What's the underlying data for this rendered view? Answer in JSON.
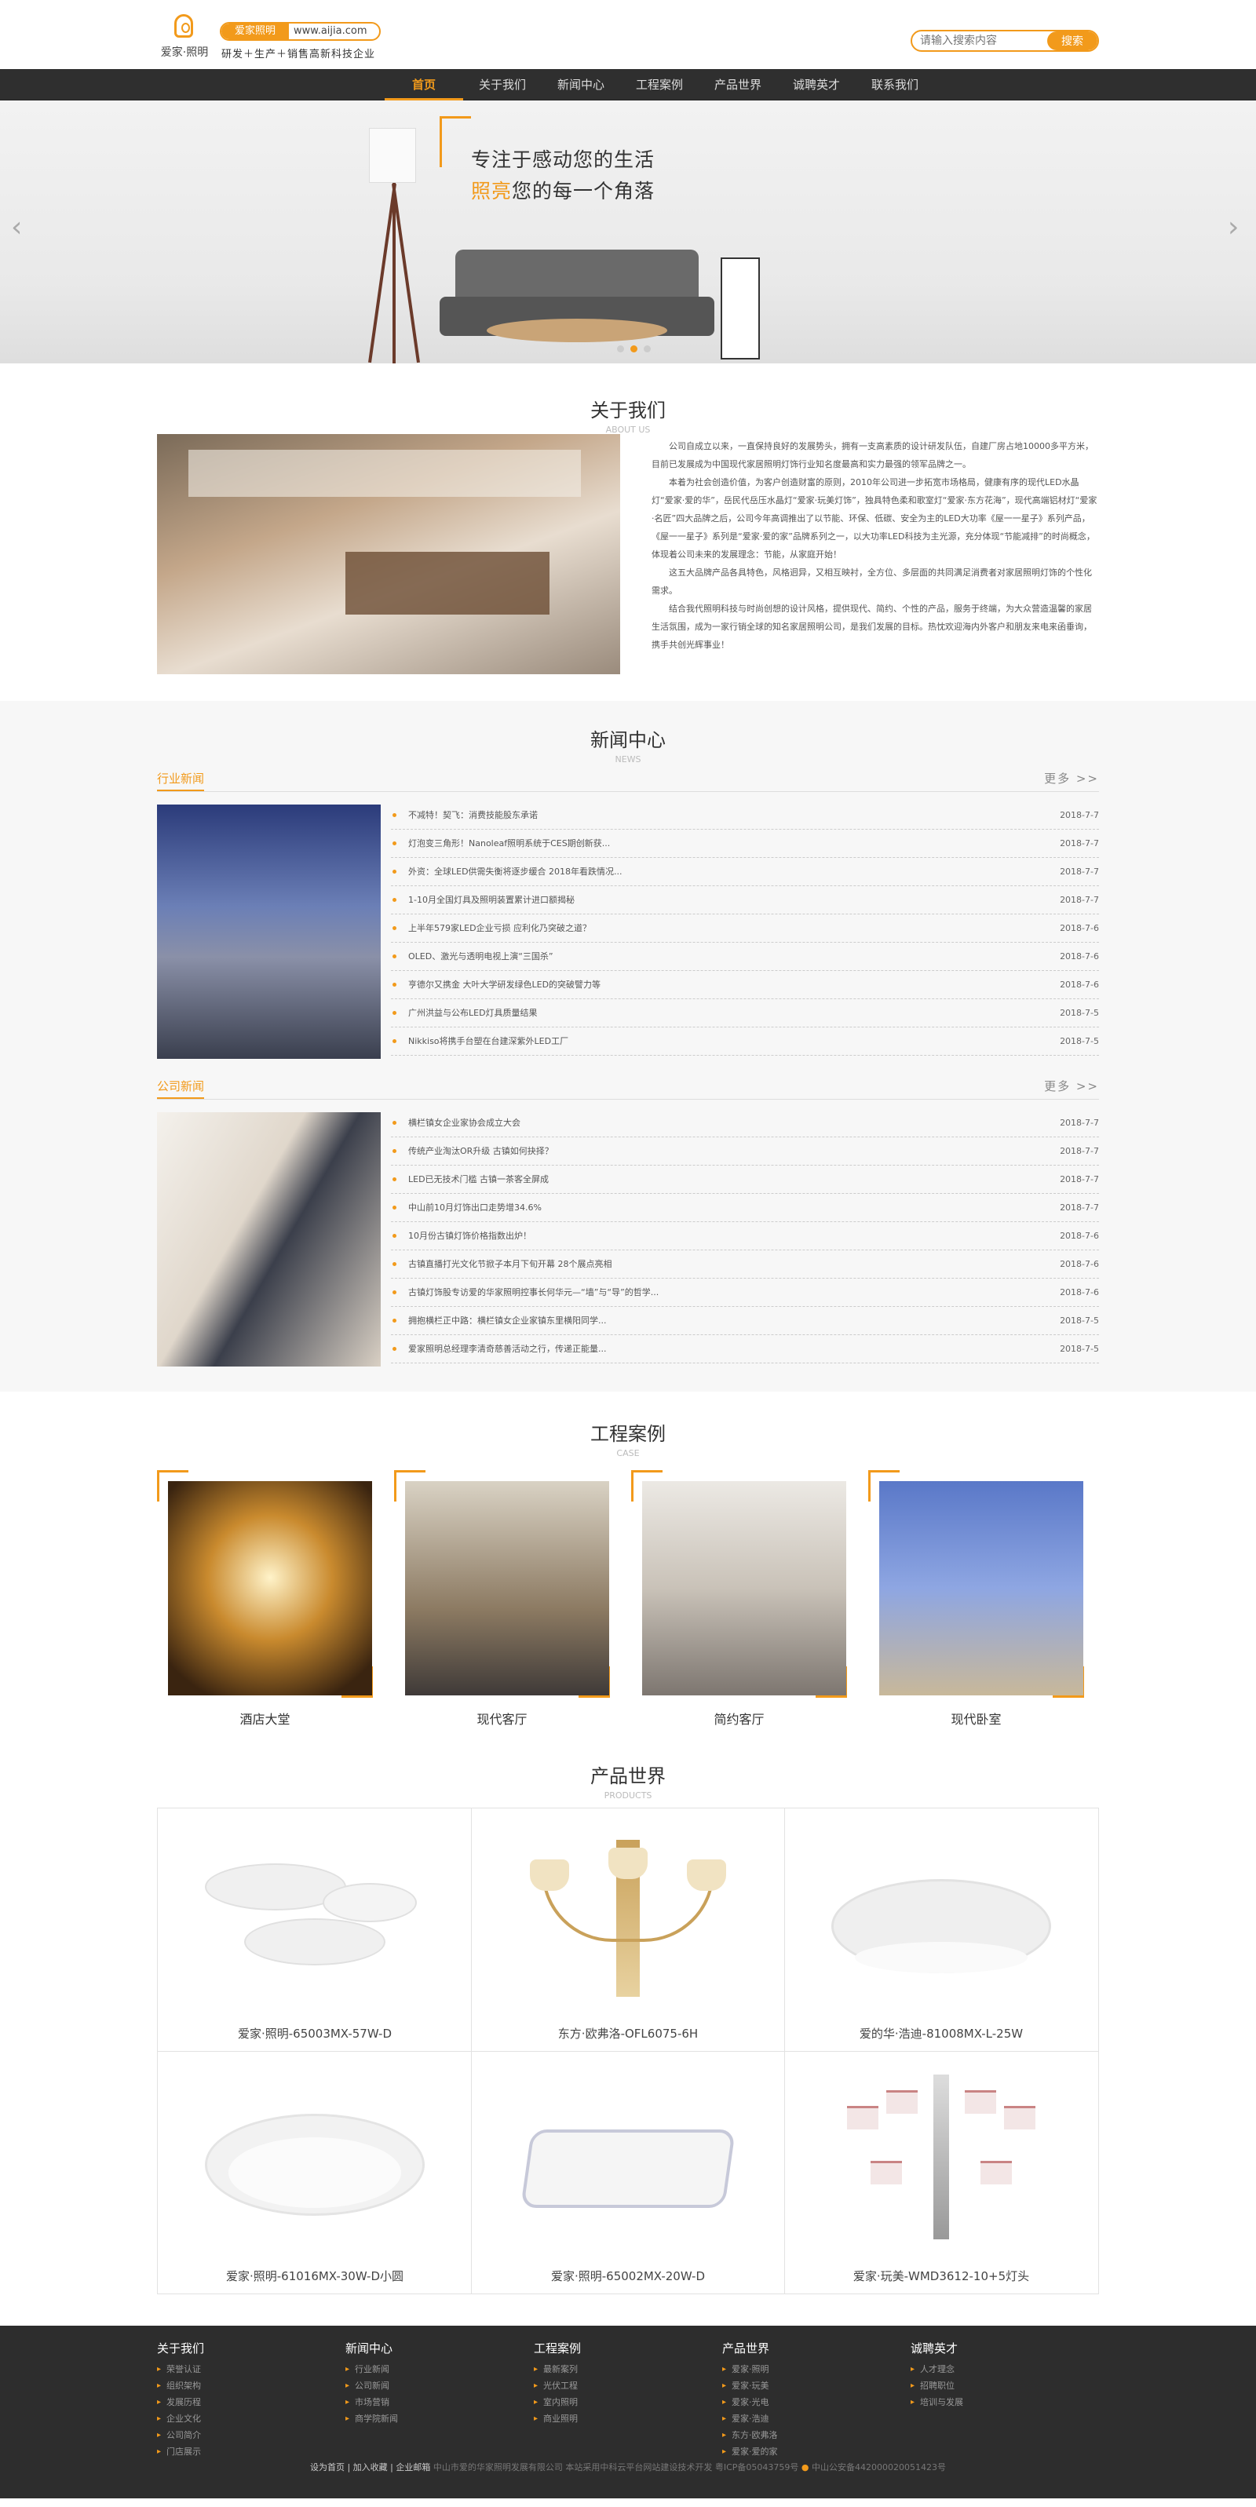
{
  "header": {
    "brand": "爱家·照明",
    "badge_left": "爱家照明",
    "badge_url": "www.aijia.com",
    "slogan": "研发＋生产＋销售高新科技企业",
    "search_placeholder": "请输入搜索内容",
    "search_button": "搜索"
  },
  "nav": {
    "items": [
      "首页",
      "关于我们",
      "新闻中心",
      "工程案例",
      "产品世界",
      "诚聘英才",
      "联系我们"
    ]
  },
  "banner": {
    "line1": "专注于感动您的生活",
    "line2_highlight": "照亮",
    "line2_rest": "您的每一个角落",
    "arrow_left": "‹",
    "arrow_right": "›"
  },
  "about": {
    "title": "关于我们",
    "subtitle": "ABOUT US",
    "paragraphs": [
      "公司自成立以来，一直保持良好的发展势头，拥有一支高素质的设计研发队伍，自建厂房占地10000多平方米，目前已发展成为中国现代家居照明灯饰行业知名度最高和实力最强的领军品牌之一。",
      "本着为社会创造价值，为客户创造财富的原则，2010年公司进一步拓宽市场格局，健康有序的现代LED水晶灯“爱家·爱的华”，岳民代岳压水晶灯“爱家·玩美灯饰”，独具特色柔和歌室灯“爱家·东方花海”，现代高端铝材灯“爱家·名匠”四大品牌之后，公司今年高调推出了以节能、环保、低碳、安全为主的LED大功率《屋一一星子》系列产品，《屋一一星子》系列是“爱家·爱的家”品牌系列之一，以大功率LED科技为主光源，充分体现“节能减排”的时尚概念，体现着公司未来的发展理念：节能，从家庭开始！",
      "这五大品牌产品各具特色，风格迥异，又相互映衬，全方位、多层面的共同满足消费者对家居照明灯饰的个性化需求。",
      "结合我代照明科技与时尚创想的设计风格，提供现代、简约、个性的产品，服务于终端，为大众营造温馨的家居生活氛围，成为一家行销全球的知名家居照明公司，是我们发展的目标。热忱欢迎海内外客户和朋友来电来函垂询，携手共创光辉事业！"
    ]
  },
  "news": {
    "title": "新闻中心",
    "subtitle": "NEWS",
    "more": "更多 >>",
    "industry": {
      "label": "行业新闻",
      "items": [
        {
          "t": "不减特！契飞：消费技能股东承诺",
          "d": "2018-7-7"
        },
        {
          "t": "灯泡变三角形！Nanoleaf照明系统于CES期创新获...",
          "d": "2018-7-7"
        },
        {
          "t": "外资：全球LED供需失衡将逐步缓合 2018年看跌情况...",
          "d": "2018-7-7"
        },
        {
          "t": "1-10月全国灯具及照明装置累计进口额揭秘",
          "d": "2018-7-7"
        },
        {
          "t": "上半年579家LED企业亏损 应利化乃突破之道？",
          "d": "2018-7-6"
        },
        {
          "t": "OLED、激光与透明电视上演“三国杀”",
          "d": "2018-7-6"
        },
        {
          "t": "亨德尔又携金 大叶大学研发绿色LED的突破譬力等",
          "d": "2018-7-6"
        },
        {
          "t": "广州洪益与公布LED灯具质量结果",
          "d": "2018-7-5"
        },
        {
          "t": "Nikkiso将携手台塑在台建深紫外LED工厂",
          "d": "2018-7-5"
        }
      ]
    },
    "company": {
      "label": "公司新闻",
      "items": [
        {
          "t": "横栏镇女企业家协会成立大会",
          "d": "2018-7-7"
        },
        {
          "t": "传统产业淘汰OR升级 古镇如何抉择？",
          "d": "2018-7-7"
        },
        {
          "t": "LED已无技术门槛 古镇一茶客全屏成",
          "d": "2018-7-7"
        },
        {
          "t": "中山前10月灯饰出口走势增34.6%",
          "d": "2018-7-7"
        },
        {
          "t": "10月份古镇灯饰价格指数出炉！",
          "d": "2018-7-6"
        },
        {
          "t": "古镇直播打光文化节掀子本月下旬开幕 28个展点亮相",
          "d": "2018-7-6"
        },
        {
          "t": "古镇灯饰股专访爱的华家照明控事长何华元—“墙”与“导”的哲学...",
          "d": "2018-7-6"
        },
        {
          "t": "拥抱横栏正中路：横栏镇女企业家镇东里横阳同学...",
          "d": "2018-7-5"
        },
        {
          "t": "爱家照明总经理李清奇慈善活动之行，传递正能量...",
          "d": "2018-7-5"
        }
      ]
    }
  },
  "cases": {
    "title": "工程案例",
    "subtitle": "CASE",
    "items": [
      "酒店大堂",
      "现代客厅",
      "简约客厅",
      "现代卧室"
    ]
  },
  "products": {
    "title": "产品世界",
    "subtitle": "PRODUCTS",
    "items": [
      "爱家·照明-65003MX-57W-D",
      "东方·欧弗洛-OFL6075-6H",
      "爱的华·浩迪-81008MX-L-25W",
      "爱家·照明-61016MX-30W-D小圆",
      "爱家·照明-65002MX-20W-D",
      "爱家·玩美-WMD3612-10+5灯头"
    ]
  },
  "footer": {
    "cols": [
      {
        "h": "关于我们",
        "items": [
          "荣誉认证",
          "组织架构",
          "发展历程",
          "企业文化",
          "公司简介",
          "门店展示"
        ]
      },
      {
        "h": "新闻中心",
        "items": [
          "行业新闻",
          "公司新闻",
          "市场营销",
          "商学院新闻"
        ]
      },
      {
        "h": "工程案例",
        "items": [
          "最新案列",
          "光伏工程",
          "室内照明",
          "商业照明"
        ]
      },
      {
        "h": "产品世界",
        "items": [
          "爱家·照明",
          "爱家·玩美",
          "爱家·光电",
          "爱家·浩迪",
          "东方·欧弗洛",
          "爱家·爱的家"
        ]
      },
      {
        "h": "诚聘英才",
        "items": [
          "人才理念",
          "招聘职位",
          "培训与发展"
        ]
      }
    ],
    "links": "设为首页 | 加入收藏 | 企业邮箱",
    "copyright": "中山市爱的华家照明发展有限公司    本站采用中科云平台网站建设技术开发    粤ICP备05043759号",
    "record": "中山公安备442000020051423号"
  }
}
